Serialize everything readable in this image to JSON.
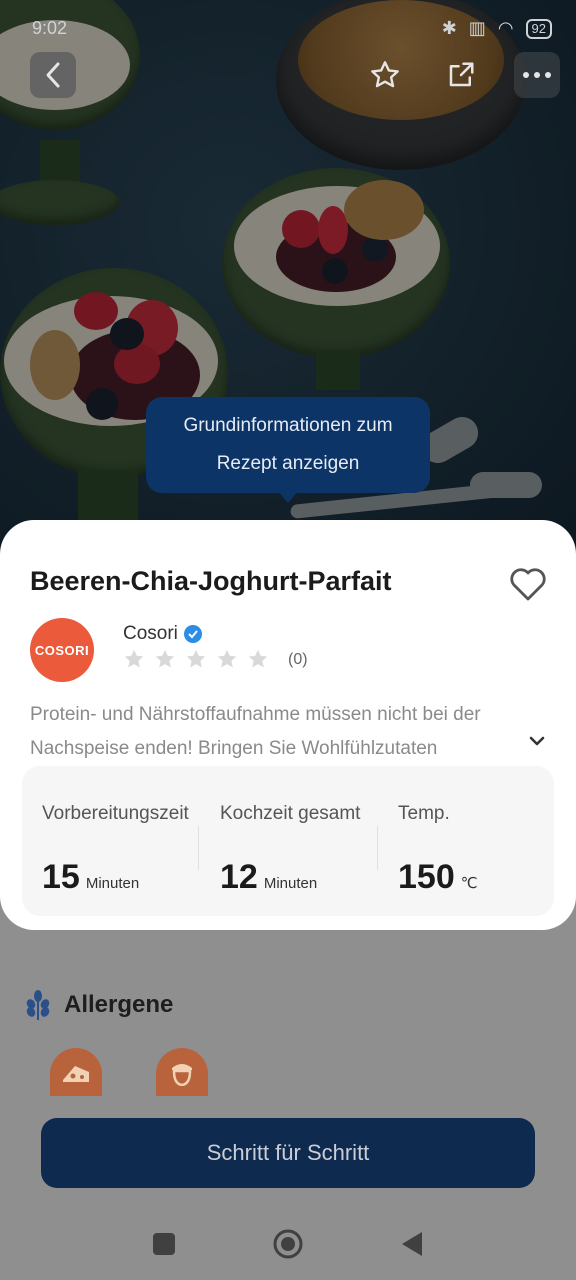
{
  "status_bar": {
    "time": "9:02",
    "battery": "92"
  },
  "top_actions": {
    "back_icon": "chevron-left-icon",
    "favorite_icon": "star-icon",
    "share_icon": "share-icon",
    "more_icon": "more-icon"
  },
  "tooltip": {
    "line1": "Grundinformationen zum",
    "line2": "Rezept anzeigen"
  },
  "recipe": {
    "title": "Beeren-Chia-Joghurt-Parfait",
    "author": "Cosori",
    "logo_text": "COSORI",
    "rating_count": "(0)",
    "rating": 0,
    "description": "Protein- und Nährstoffaufnahme müssen nicht bei der Nachspeise enden! Bringen Sie Wohlfühlzutaten",
    "info": [
      {
        "label": "Vorbereitungszeit",
        "value": "15",
        "unit": "Minuten"
      },
      {
        "label": "Kochzeit gesamt",
        "value": "12",
        "unit": "Minuten"
      },
      {
        "label": "Temp.",
        "value": "150",
        "unit": "℃"
      }
    ]
  },
  "allergens": {
    "title": "Allergene",
    "items": [
      "cheese-icon",
      "acorn-icon"
    ]
  },
  "step_button": "Schritt für Schritt",
  "colors": {
    "tooltip": "#0d3466",
    "button": "#0e2a4f",
    "logo": "#ea5a3b",
    "verified": "#2a8de8"
  }
}
